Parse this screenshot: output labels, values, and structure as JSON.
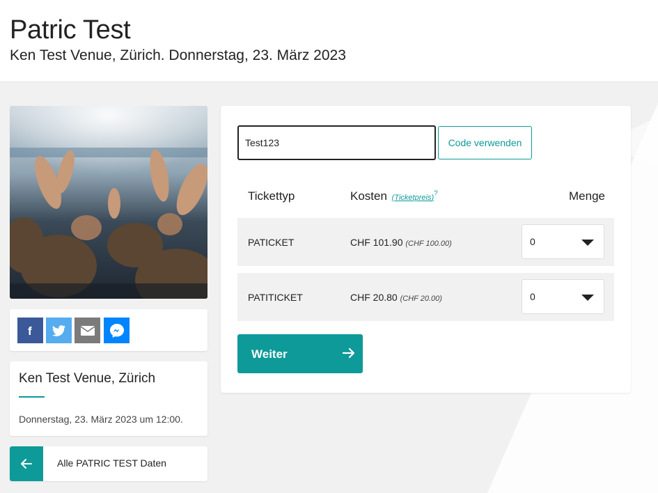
{
  "header": {
    "title": "Patric Test",
    "subtitle": "Ken Test Venue, Zürich. Donnerstag, 23. März 2023"
  },
  "share": {
    "buttons": [
      {
        "icon": "facebook-icon",
        "color": "#3b5998"
      },
      {
        "icon": "twitter-icon",
        "color": "#55acee"
      },
      {
        "icon": "mail-icon",
        "color": "#7b7b7b"
      },
      {
        "icon": "messenger-icon",
        "color": "#0084ff"
      }
    ]
  },
  "venue": {
    "name": "Ken Test Venue, Zürich",
    "date": "Donnerstag, 23. März 2023 um 12:00."
  },
  "back": {
    "label": "Alle PATRIC TEST Daten",
    "icon": "arrow-left-icon"
  },
  "promo": {
    "value": "Test123",
    "button_label": "Code verwenden"
  },
  "table": {
    "col_type": "Tickettyp",
    "col_cost": "Kosten",
    "price_link": "Ticketpreis",
    "price_q": "?",
    "col_qty": "Menge",
    "rows": [
      {
        "name": "PATICKET",
        "price": "CHF 101.90",
        "base": "(CHF 100.00)",
        "qty": "0"
      },
      {
        "name": "PATITICKET",
        "price": "CHF 20.80",
        "base": "(CHF 20.00)",
        "qty": "0"
      }
    ]
  },
  "next": {
    "label": "Weiter",
    "icon": "arrow-right-icon"
  },
  "colors": {
    "accent": "#0e9a98",
    "background": "#f1f1f1"
  }
}
